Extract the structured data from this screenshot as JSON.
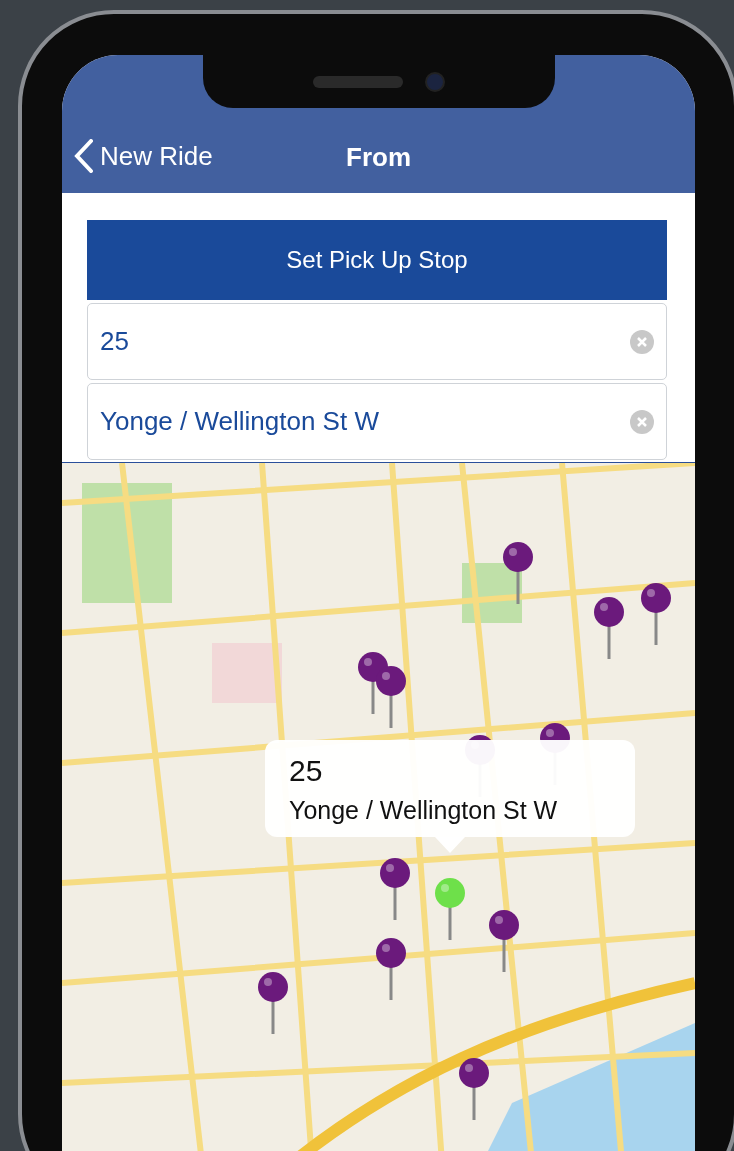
{
  "header": {
    "back_label": "New Ride",
    "title": "From"
  },
  "set_button": {
    "label": "Set Pick Up Stop"
  },
  "fields": [
    {
      "value": "25"
    },
    {
      "value": "Yonge / Wellington St W"
    }
  ],
  "map": {
    "callout": {
      "title": "25",
      "subtitle": "Yonge / Wellington St W"
    },
    "pins": [
      {
        "selected": false
      },
      {
        "selected": false
      },
      {
        "selected": false
      },
      {
        "selected": false
      },
      {
        "selected": false
      },
      {
        "selected": false
      },
      {
        "selected": false
      },
      {
        "selected": false
      },
      {
        "selected": true
      },
      {
        "selected": false
      },
      {
        "selected": false
      },
      {
        "selected": false
      },
      {
        "selected": false
      }
    ]
  }
}
